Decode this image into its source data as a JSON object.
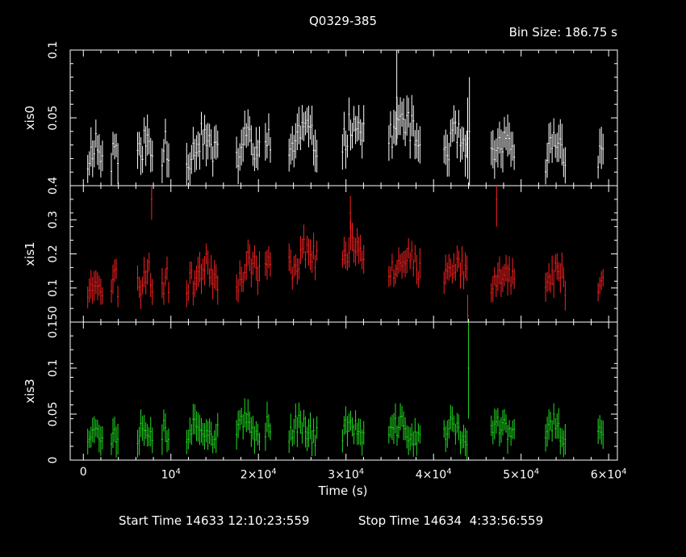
{
  "chart_data": {
    "type": "scatter",
    "title": "Q0329-385",
    "bin_size": "Bin Size: 186.75 s",
    "xlabel": "Time (s)",
    "xlim": [
      -1500,
      61000
    ],
    "x_ticks": [
      {
        "value": 0,
        "label": "0"
      },
      {
        "value": 10000,
        "label": "10<sup>4</sup>"
      },
      {
        "value": 20000,
        "label": "2×10<sup>4</sup>"
      },
      {
        "value": 30000,
        "label": "3×10<sup>4</sup>"
      },
      {
        "value": 40000,
        "label": "4×10<sup>4</sup>"
      },
      {
        "value": 50000,
        "label": "5×10<sup>4</sup>"
      },
      {
        "value": 60000,
        "label": "6×10<sup>4</sup>"
      }
    ],
    "start_time": "Start Time 14633 12:10:23:559",
    "stop_time": "Stop Time 14634  4:33:56:559",
    "segments": [
      [
        500,
        2200
      ],
      [
        3200,
        4000
      ],
      [
        6200,
        8000
      ],
      [
        9000,
        9800
      ],
      [
        11800,
        15400
      ],
      [
        17500,
        20200
      ],
      [
        20800,
        21500
      ],
      [
        23500,
        26800
      ],
      [
        29600,
        32200
      ],
      [
        34900,
        38500
      ],
      [
        41200,
        44000
      ],
      [
        46600,
        49300
      ],
      [
        52800,
        55200
      ],
      [
        58800,
        59500
      ]
    ],
    "panels": [
      {
        "name": "xis0",
        "ylabel": "xis0",
        "color": "#ffffff",
        "ylim": [
          0,
          0.1
        ],
        "yticks": [
          {
            "value": 0.05,
            "label": "0.05"
          },
          {
            "value": 0.1,
            "label": "0.1"
          }
        ],
        "base": [
          [
            0,
            0.025
          ],
          [
            20000,
            0.03
          ],
          [
            35000,
            0.045
          ],
          [
            45000,
            0.025
          ],
          [
            60000,
            0.03
          ]
        ],
        "amp": 0.012,
        "err": 0.012,
        "seed": 11,
        "spikes": [
          [
            35800,
            0.065,
            0.035
          ],
          [
            43900,
            0.035,
            0.03
          ],
          [
            44100,
            0.04,
            0.04
          ]
        ]
      },
      {
        "name": "xis1",
        "ylabel": "xis1",
        "color": "#ff2020",
        "ylim": [
          0,
          0.4
        ],
        "yticks": [
          {
            "value": 0.1,
            "label": "0.1"
          },
          {
            "value": 0.2,
            "label": "0.2"
          },
          {
            "value": 0.3,
            "label": "0.3"
          },
          {
            "value": 0.4,
            "label": "0.4"
          }
        ],
        "base": [
          [
            0,
            0.11
          ],
          [
            18000,
            0.15
          ],
          [
            30000,
            0.22
          ],
          [
            40000,
            0.15
          ],
          [
            60000,
            0.12
          ]
        ],
        "amp": 0.04,
        "err": 0.035,
        "seed": 23,
        "spikes": [
          [
            7800,
            0.36,
            0.06
          ],
          [
            30500,
            0.32,
            0.05
          ],
          [
            47200,
            0.36,
            0.08
          ],
          [
            43900,
            0.02,
            0.06
          ]
        ]
      },
      {
        "name": "xis3",
        "ylabel": "xis3",
        "color": "#20e020",
        "ylim": [
          0,
          0.15
        ],
        "yticks": [
          {
            "value": 0,
            "label": "0"
          },
          {
            "value": 0.05,
            "label": "0.05"
          },
          {
            "value": 0.1,
            "label": "0.1"
          },
          {
            "value": 0.15,
            "label": "0.150"
          }
        ],
        "base": [
          [
            0,
            0.03
          ],
          [
            20000,
            0.035
          ],
          [
            40000,
            0.03
          ],
          [
            60000,
            0.035
          ]
        ],
        "amp": 0.012,
        "err": 0.013,
        "seed": 37,
        "spikes": [
          [
            44000,
            0.1,
            0.055
          ]
        ]
      }
    ]
  }
}
